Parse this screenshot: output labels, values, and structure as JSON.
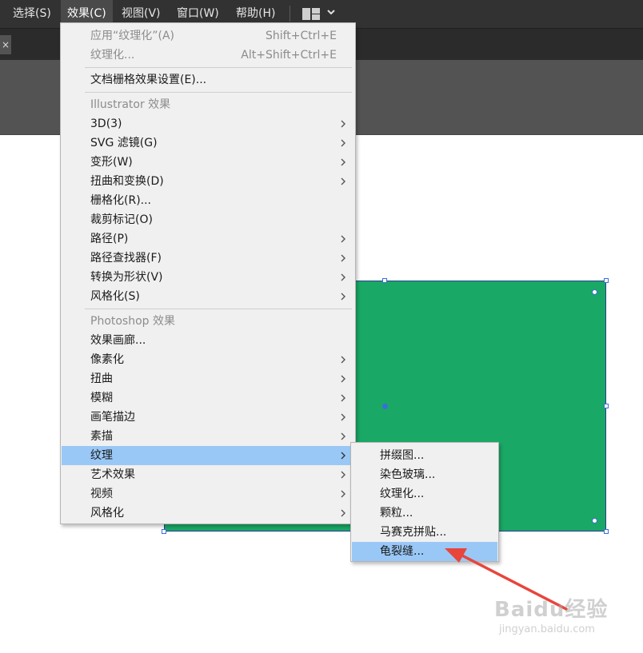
{
  "menubar": {
    "items": [
      "选择(S)",
      "效果(C)",
      "视图(V)",
      "窗口(W)",
      "帮助(H)"
    ],
    "open_index": 1
  },
  "effect_menu": {
    "apply_last": {
      "label": "应用“纹理化”(A)",
      "shortcut": "Shift+Ctrl+E"
    },
    "last_effect": {
      "label": "纹理化...",
      "shortcut": "Alt+Shift+Ctrl+E"
    },
    "doc_raster_settings": "文档栅格效果设置(E)...",
    "illustrator_header": "Illustrator 效果",
    "illustrator_items": [
      "3D(3)",
      "SVG 滤镜(G)",
      "变形(W)",
      "扭曲和变换(D)",
      "栅格化(R)...",
      "裁剪标记(O)",
      "路径(P)",
      "路径查找器(F)",
      "转换为形状(V)",
      "风格化(S)"
    ],
    "photoshop_header": "Photoshop 效果",
    "photoshop_items": [
      "效果画廊...",
      "像素化",
      "扭曲",
      "模糊",
      "画笔描边",
      "素描",
      "纹理",
      "艺术效果",
      "视频",
      "风格化"
    ]
  },
  "texture_submenu": {
    "items": [
      "拼缀图...",
      "染色玻璃...",
      "纹理化...",
      "颗粒...",
      "马赛克拼贴...",
      "龟裂缝..."
    ],
    "highlighted_index": 5
  },
  "colors": {
    "menubar_bg": "#323232",
    "menu_bg": "#f0f0f0",
    "menu_highlight": "#99c8f6",
    "artwork_fill": "#1aa866",
    "selection_blue": "#3a6ed8",
    "arrow_red": "#e8453c"
  },
  "watermark": {
    "top": "Baidu经验",
    "bottom": "jingyan.baidu.com"
  }
}
